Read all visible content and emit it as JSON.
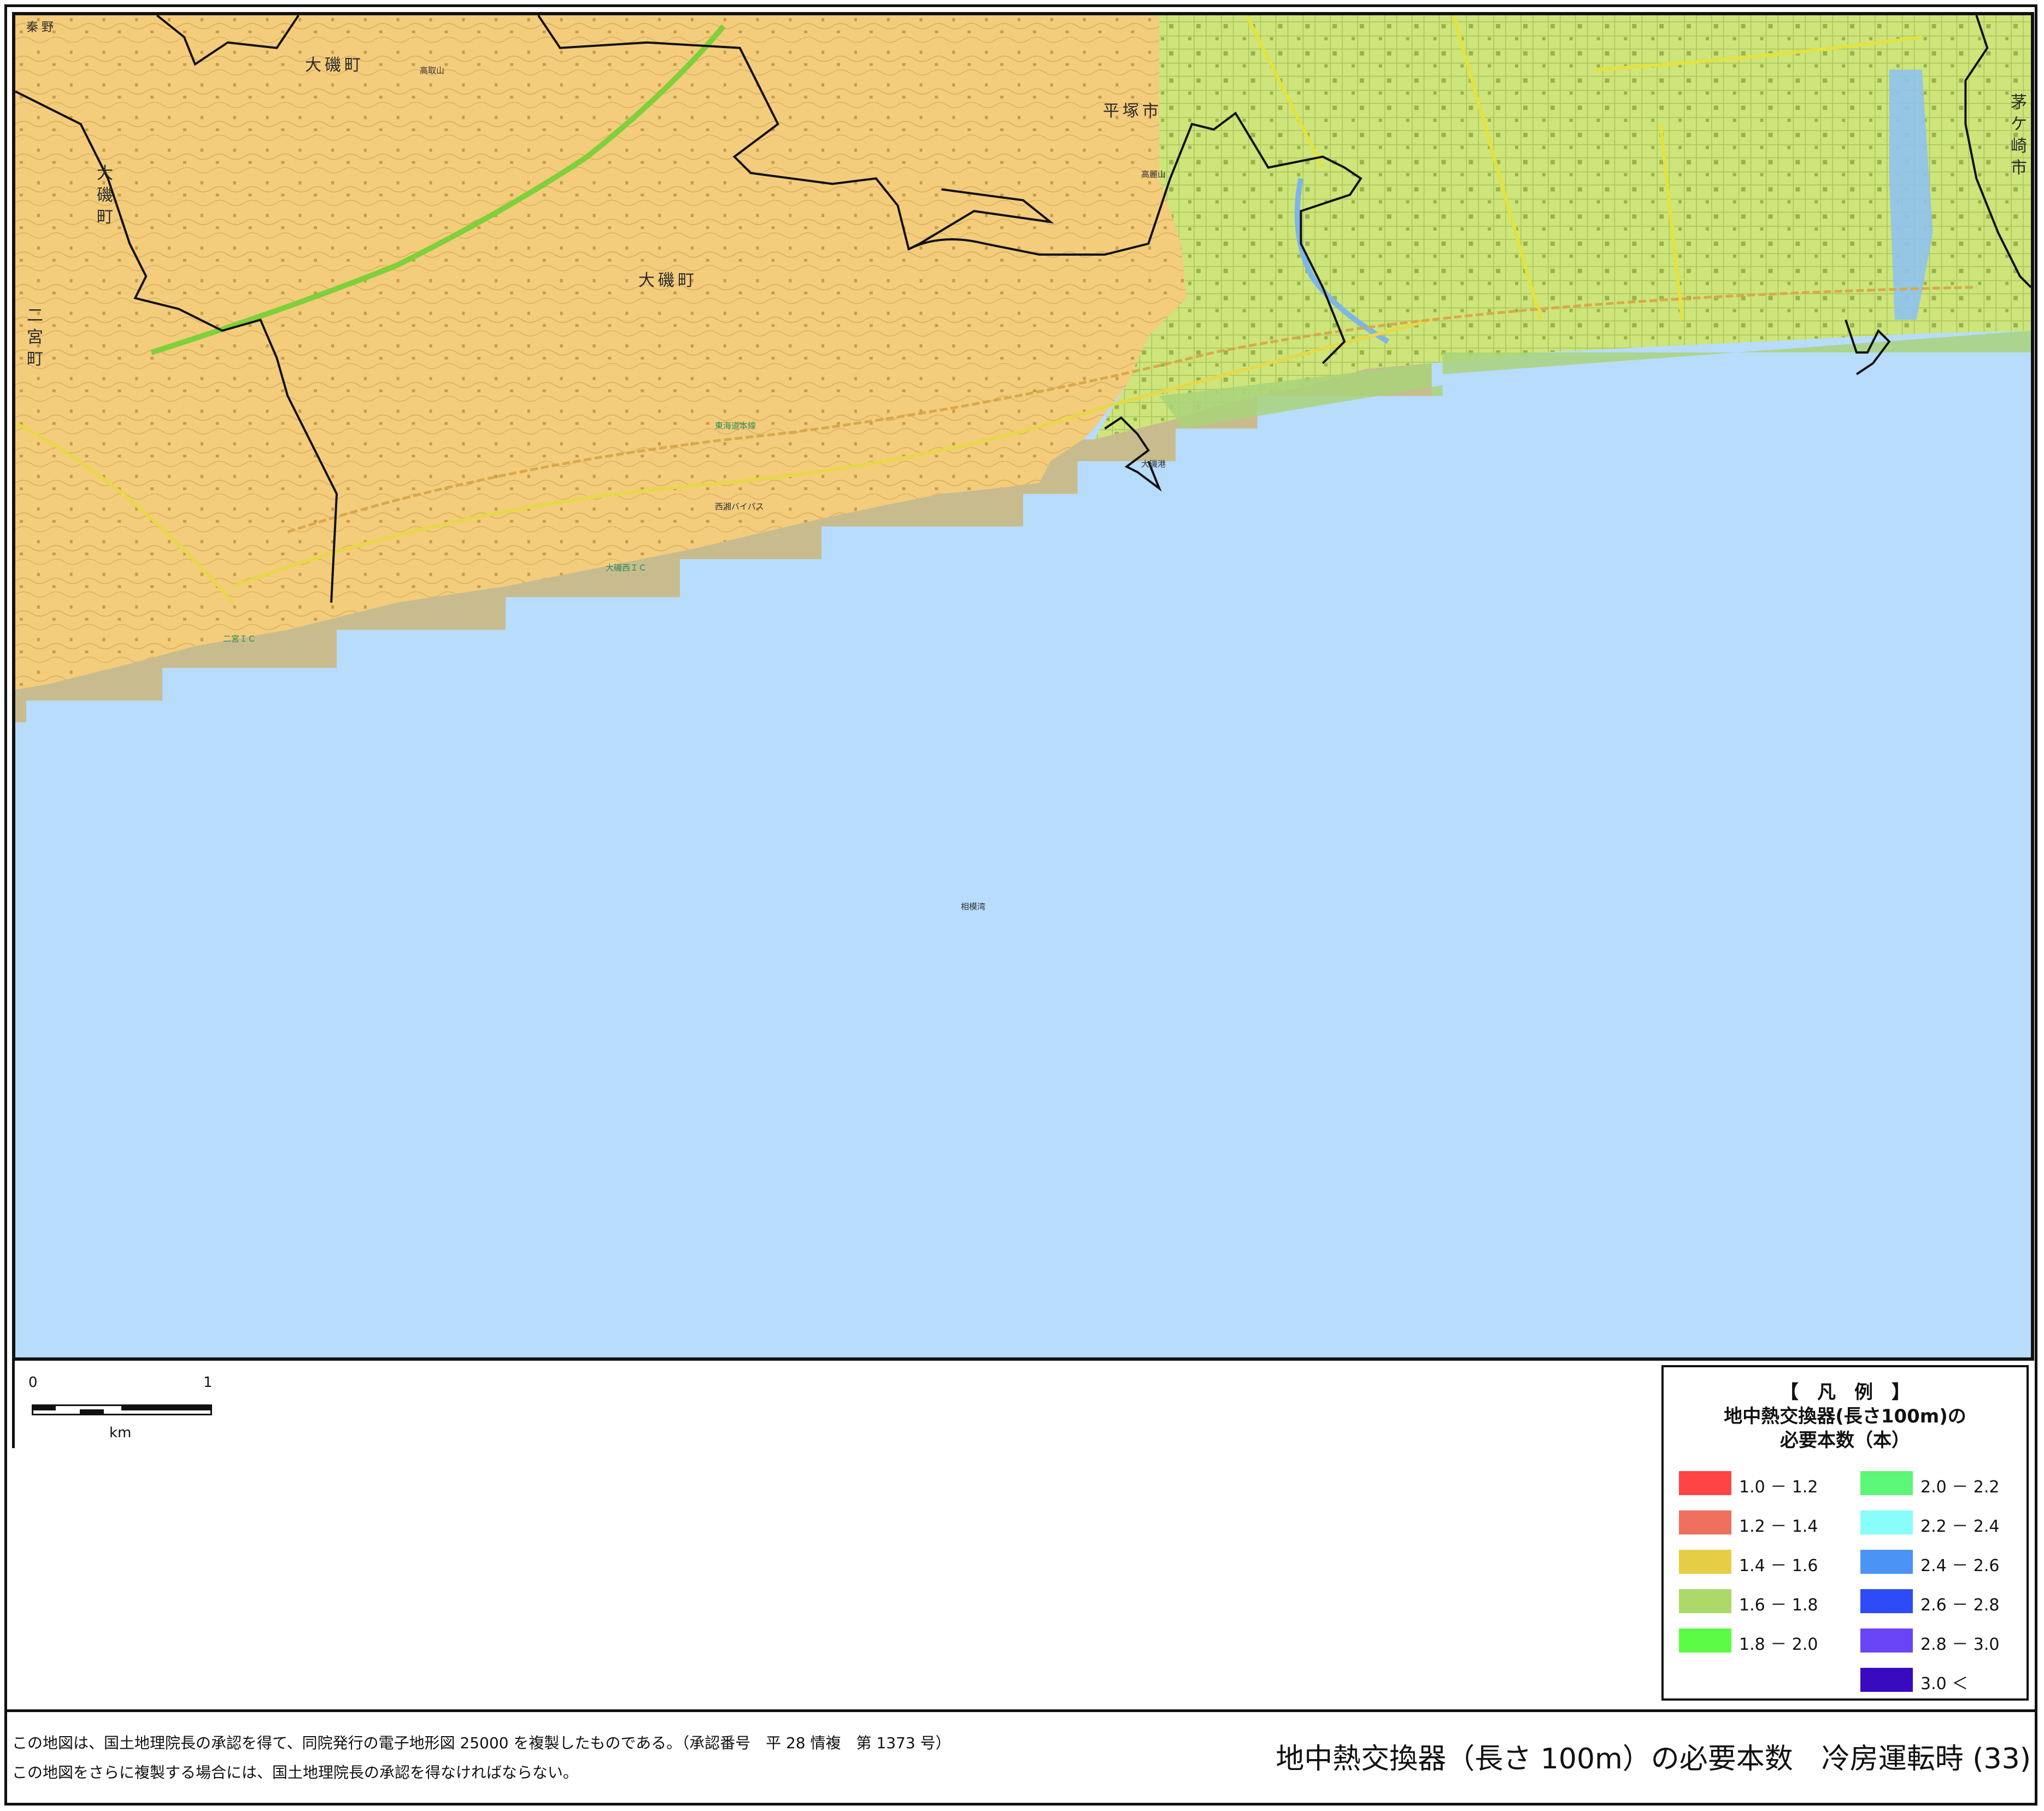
{
  "map": {
    "place_labels": {
      "oiso_top": "大磯町",
      "oiso_center": "大磯町",
      "oiso_left": "大磯町",
      "ninomiya": "二宮町",
      "hiratsuka": "平塚市",
      "chigasaki": "茅ケ崎市",
      "takatori": "高取山",
      "koma": "高麗山",
      "sagami_bay": "相模湾",
      "oiso_port": "大磯港",
      "oiso_ic": "大磯西ＩＣ",
      "ninomiya_ic": "二宮ＩＣ",
      "top_left_partial": "秦野",
      "shonan_bypass": "西湘バイパス",
      "tokaido_line": "東海道本線"
    },
    "colors": {
      "sea": "#b7dcfc",
      "class_1_4_1_6": "#f3cc7c",
      "class_1_6_1_8": "#cde57a",
      "shoreline_sand": "#c8bc8e",
      "boundary": "#111111"
    }
  },
  "scale": {
    "start_label": "0",
    "end_label": "1",
    "unit": "km"
  },
  "legend": {
    "title_line1": "【　凡　例　】",
    "title_line2": "地中熱交換器(長さ100m)の",
    "title_line3": "必要本数（本）",
    "items": [
      {
        "label": "1.0 － 1.2",
        "color": "#fe4444"
      },
      {
        "label": "1.2 － 1.4",
        "color": "#f0705f"
      },
      {
        "label": "1.4 － 1.6",
        "color": "#e6cd46"
      },
      {
        "label": "1.6 － 1.8",
        "color": "#acd96a"
      },
      {
        "label": "1.8 － 2.0",
        "color": "#5cfc46"
      },
      {
        "label": "2.0 － 2.2",
        "color": "#5cf678"
      },
      {
        "label": "2.2 － 2.4",
        "color": "#88fdfa"
      },
      {
        "label": "2.4 － 2.6",
        "color": "#4b94f6"
      },
      {
        "label": "2.6 － 2.8",
        "color": "#2d4cf8"
      },
      {
        "label": "2.8 － 3.0",
        "color": "#6a45f6"
      },
      {
        "label": "3.0 ＜",
        "color": "#3a0ac0"
      }
    ]
  },
  "footer": {
    "note_line1": "この地図は、国土地理院長の承認を得て、同院発行の電子地形図 25000 を複製したものである。（承認番号　平 28 情複　第 1373 号）",
    "note_line2": "この地図をさらに複製する場合には、国土地理院長の承認を得なければならない。",
    "title": "地中熱交換器（長さ 100m）の必要本数　冷房運転時 (33)"
  }
}
